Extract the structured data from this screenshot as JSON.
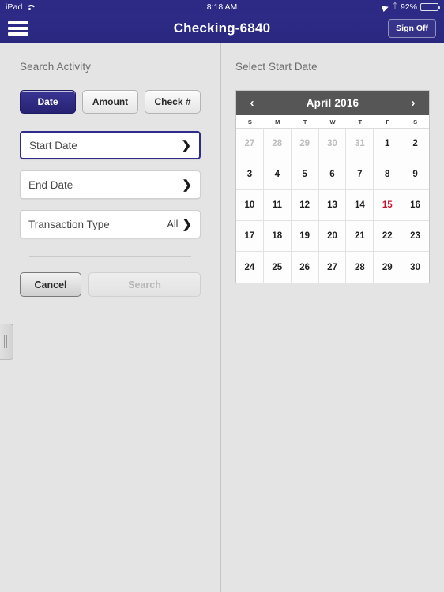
{
  "status_bar": {
    "carrier": "iPad",
    "wifi_icon": "wifi-icon",
    "time": "8:18 AM",
    "location_icon": "location-arrow-icon",
    "bluetooth_icon": "bluetooth-icon",
    "battery_percent": "92%"
  },
  "nav_bar": {
    "menu_icon": "hamburger-menu-icon",
    "title": "Checking-6840",
    "sign_off_label": "Sign Off"
  },
  "left_panel": {
    "section_title": "Search Activity",
    "segments": [
      {
        "label": "Date",
        "active": true
      },
      {
        "label": "Amount",
        "active": false
      },
      {
        "label": "Check #",
        "active": false
      }
    ],
    "fields": [
      {
        "label": "Start Date",
        "value": "",
        "selected": true
      },
      {
        "label": "End Date",
        "value": "",
        "selected": false
      },
      {
        "label": "Transaction Type",
        "value": "All",
        "selected": false
      }
    ],
    "cancel_label": "Cancel",
    "search_label": "Search"
  },
  "right_panel": {
    "section_title": "Select Start Date",
    "calendar": {
      "prev_label": "‹",
      "next_label": "›",
      "month_title": "April 2016",
      "weekdays": [
        "S",
        "M",
        "T",
        "W",
        "T",
        "F",
        "S"
      ],
      "today": "15",
      "days": [
        {
          "n": "27",
          "muted": true
        },
        {
          "n": "28",
          "muted": true
        },
        {
          "n": "29",
          "muted": true
        },
        {
          "n": "30",
          "muted": true
        },
        {
          "n": "31",
          "muted": true
        },
        {
          "n": "1",
          "muted": false
        },
        {
          "n": "2",
          "muted": false
        },
        {
          "n": "3",
          "muted": false
        },
        {
          "n": "4",
          "muted": false
        },
        {
          "n": "5",
          "muted": false
        },
        {
          "n": "6",
          "muted": false
        },
        {
          "n": "7",
          "muted": false
        },
        {
          "n": "8",
          "muted": false
        },
        {
          "n": "9",
          "muted": false
        },
        {
          "n": "10",
          "muted": false
        },
        {
          "n": "11",
          "muted": false
        },
        {
          "n": "12",
          "muted": false
        },
        {
          "n": "13",
          "muted": false
        },
        {
          "n": "14",
          "muted": false
        },
        {
          "n": "15",
          "muted": false,
          "today": true
        },
        {
          "n": "16",
          "muted": false
        },
        {
          "n": "17",
          "muted": false
        },
        {
          "n": "18",
          "muted": false
        },
        {
          "n": "19",
          "muted": false
        },
        {
          "n": "20",
          "muted": false
        },
        {
          "n": "21",
          "muted": false
        },
        {
          "n": "22",
          "muted": false
        },
        {
          "n": "23",
          "muted": false
        },
        {
          "n": "24",
          "muted": false
        },
        {
          "n": "25",
          "muted": false
        },
        {
          "n": "26",
          "muted": false
        },
        {
          "n": "27",
          "muted": false
        },
        {
          "n": "28",
          "muted": false
        },
        {
          "n": "29",
          "muted": false
        },
        {
          "n": "30",
          "muted": false
        }
      ]
    }
  },
  "colors": {
    "brand_navy": "#2d2a86",
    "calendar_header": "#565656",
    "today_red": "#c4162c",
    "page_background": "#e4e4e4"
  }
}
